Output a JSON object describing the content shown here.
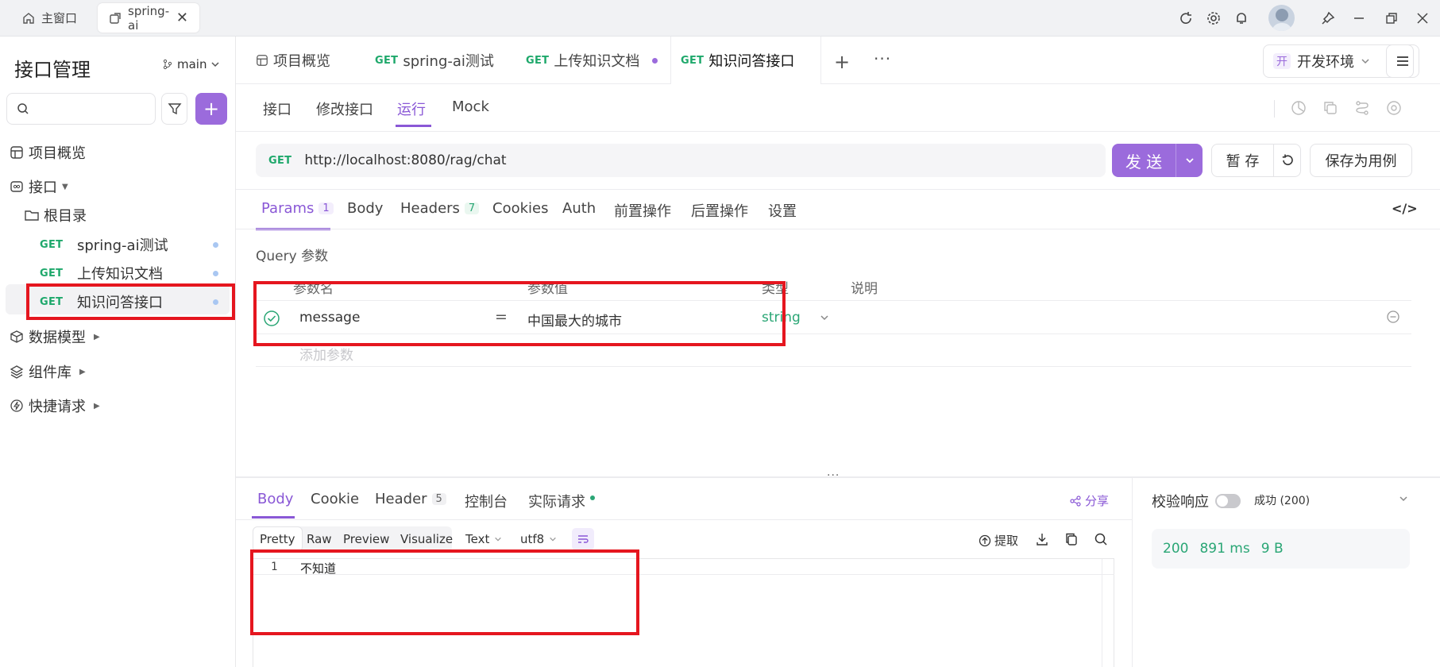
{
  "window": {
    "tabs": [
      {
        "label": "主窗口"
      },
      {
        "label": "spring-ai"
      }
    ]
  },
  "sidebar": {
    "title": "接口管理",
    "branch": "main",
    "search_placeholder": "",
    "nav": {
      "overview": "项目概览",
      "apis": "接口",
      "root": "根目录",
      "data_models": "数据模型",
      "components": "组件库",
      "quick_requests": "快捷请求"
    },
    "endpoints": [
      {
        "method": "GET",
        "name": "spring-ai测试"
      },
      {
        "method": "GET",
        "name": "上传知识文档"
      },
      {
        "method": "GET",
        "name": "知识问答接口"
      }
    ]
  },
  "tabs": {
    "overview": "项目概览",
    "open": [
      {
        "method": "GET",
        "label": "spring-ai测试"
      },
      {
        "method": "GET",
        "label": "上传知识文档"
      },
      {
        "method": "GET",
        "label": "知识问答接口"
      }
    ],
    "environment": "开发环境",
    "env_badge": "开"
  },
  "subtabs": {
    "api": "接口",
    "edit": "修改接口",
    "run": "运行",
    "mock": "Mock"
  },
  "request": {
    "method": "GET",
    "url": "http://localhost:8080/rag/chat",
    "send": "发 送",
    "save_temp": "暂 存",
    "save_case": "保存为用例"
  },
  "params_tabs": {
    "params": "Params",
    "params_count": "1",
    "body": "Body",
    "headers": "Headers",
    "headers_count": "7",
    "cookies": "Cookies",
    "auth": "Auth",
    "pre": "前置操作",
    "post": "后置操作",
    "settings": "设置"
  },
  "query": {
    "section_title": "Query 参数",
    "columns": {
      "name": "参数名",
      "value": "参数值",
      "type": "类型",
      "desc": "说明"
    },
    "rows": [
      {
        "name": "message",
        "eq": "=",
        "value": "中国最大的城市",
        "type": "string"
      }
    ],
    "add_placeholder": "添加参数"
  },
  "response": {
    "tabs": {
      "body": "Body",
      "cookie": "Cookie",
      "header": "Header",
      "header_count": "5",
      "console": "控制台",
      "actual": "实际请求"
    },
    "share": "分享",
    "formats": [
      "Pretty",
      "Raw",
      "Preview",
      "Visualize"
    ],
    "content_type": "Text",
    "encoding": "utf8",
    "extract": "提取",
    "code_lines": [
      {
        "num": "1",
        "text": "不知道"
      }
    ],
    "validate_label": "校验响应",
    "result": "成功 (200)",
    "status_code": "200",
    "time": "891 ms",
    "size": "9 B"
  },
  "colors": {
    "accent": "#9b6bdc",
    "get_method": "#1ea86b",
    "annotation_red": "#e5161f"
  }
}
